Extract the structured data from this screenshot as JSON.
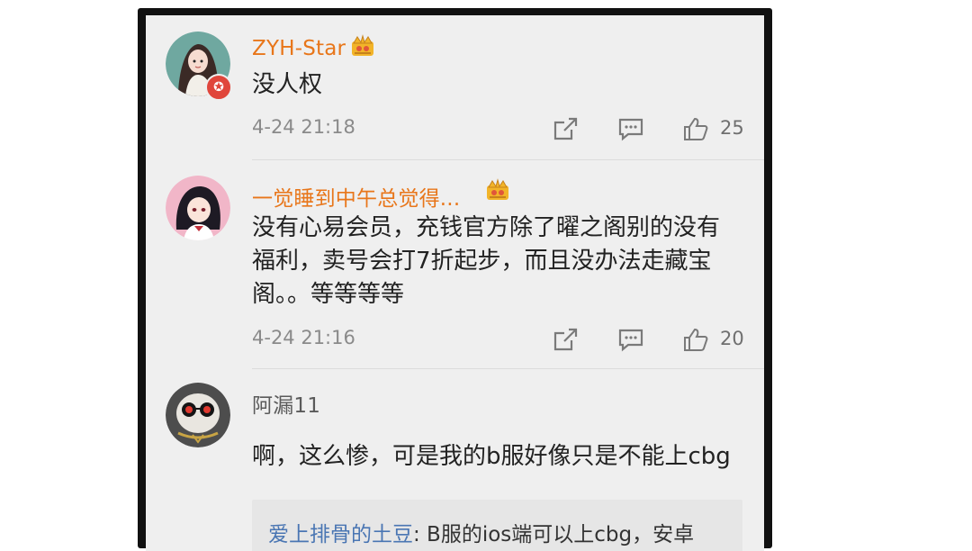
{
  "comments": [
    {
      "username": "ZYH-Star",
      "text": "没人权",
      "time": "4-24 21:18",
      "likes": "25",
      "verified": true,
      "crown": true
    },
    {
      "username": "一觉睡到中午总觉得...",
      "text": "没有心易会员，充钱官方除了曜之阁别的没有福利，卖号会打7折起步，而且没办法走藏宝阁。。等等等等",
      "time": "4-24 21:16",
      "likes": "20",
      "verified": false,
      "crown": true
    },
    {
      "username": "阿漏11",
      "text": "啊，这么惨，可是我的b服好像只是不能上cbg",
      "verified": false,
      "crown": false,
      "reply": {
        "name": "爱上排骨的土豆",
        "text": ": B服的ios端可以上cbg，安卓"
      }
    }
  ],
  "icons": {
    "share": "share-icon",
    "comment": "comment-icon",
    "like": "thumbs-up-icon",
    "crown": "crown-vip-icon",
    "verified": "verified-star-icon"
  },
  "colors": {
    "vip_name": "#e8761a",
    "reply_name": "#4a76b3",
    "background": "#efefef"
  }
}
